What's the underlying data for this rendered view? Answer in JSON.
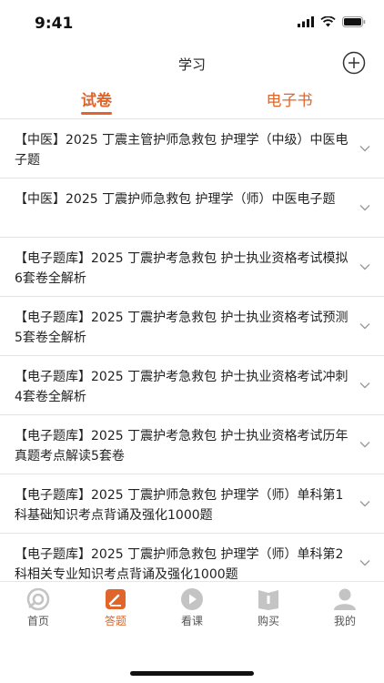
{
  "status_bar": {
    "time": "9:41"
  },
  "header": {
    "title": "学习",
    "add_icon": "plus-circle-icon"
  },
  "tabs": [
    {
      "label": "试卷",
      "active": true
    },
    {
      "label": "电子书",
      "active": false
    }
  ],
  "items": [
    {
      "title": "【中医】2025 丁震主管护师急救包 护理学（中级）中医电子题"
    },
    {
      "title": "【中医】2025 丁震护师急救包 护理学（师）中医电子题"
    },
    {
      "title": "【电子题库】2025 丁震护考急救包 护士执业资格考试模拟6套卷全解析"
    },
    {
      "title": "【电子题库】2025 丁震护考急救包 护士执业资格考试预测5套卷全解析"
    },
    {
      "title": "【电子题库】2025 丁震护考急救包 护士执业资格考试冲刺4套卷全解析"
    },
    {
      "title": "【电子题库】2025 丁震护考急救包 护士执业资格考试历年真题考点解读5套卷"
    },
    {
      "title": "【电子题库】2025 丁震护师急救包 护理学（师）单科第1科基础知识考点背诵及强化1000题"
    },
    {
      "title": "【电子题库】2025 丁震护师急救包 护理学（师）单科第2科相关专业知识考点背诵及强化1000题"
    }
  ],
  "bottom_nav": [
    {
      "label": "首页",
      "icon": "home-icon",
      "active": false
    },
    {
      "label": "答题",
      "icon": "answer-icon",
      "active": true
    },
    {
      "label": "看课",
      "icon": "play-icon",
      "active": false
    },
    {
      "label": "购买",
      "icon": "book-icon",
      "active": false
    },
    {
      "label": "我的",
      "icon": "user-icon",
      "active": false
    }
  ],
  "colors": {
    "accent": "#e0652a",
    "inactive_icon": "#c4c4c4"
  }
}
